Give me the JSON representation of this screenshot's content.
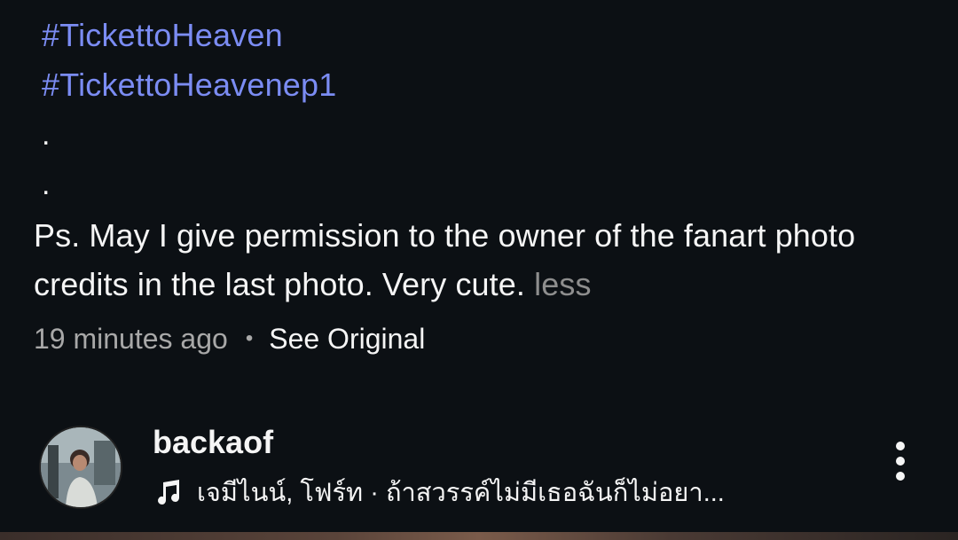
{
  "caption": {
    "hashtags": [
      "#TickettoHeaven",
      "#TickettoHeavenep1"
    ],
    "dots": [
      ".",
      "."
    ],
    "text": "Ps. May I give permission to the owner of the fanart photo credits in the last photo. Very cute.",
    "less_label": "less"
  },
  "meta": {
    "time": "19 minutes ago",
    "separator": "•",
    "see_original_label": "See Original"
  },
  "post": {
    "username": "backaof",
    "music": "เจมีไนน์, โฟร์ท · ถ้าสวรรค์ไม่มีเธอฉันก็ไม่อยา...",
    "music_icon": "music-note-icon",
    "more_icon": "more-vertical-icon"
  },
  "colors": {
    "background": "#0c1014",
    "hashtag": "#7b8cf3",
    "text": "#f5f5f5",
    "muted": "#a8a8a8"
  }
}
